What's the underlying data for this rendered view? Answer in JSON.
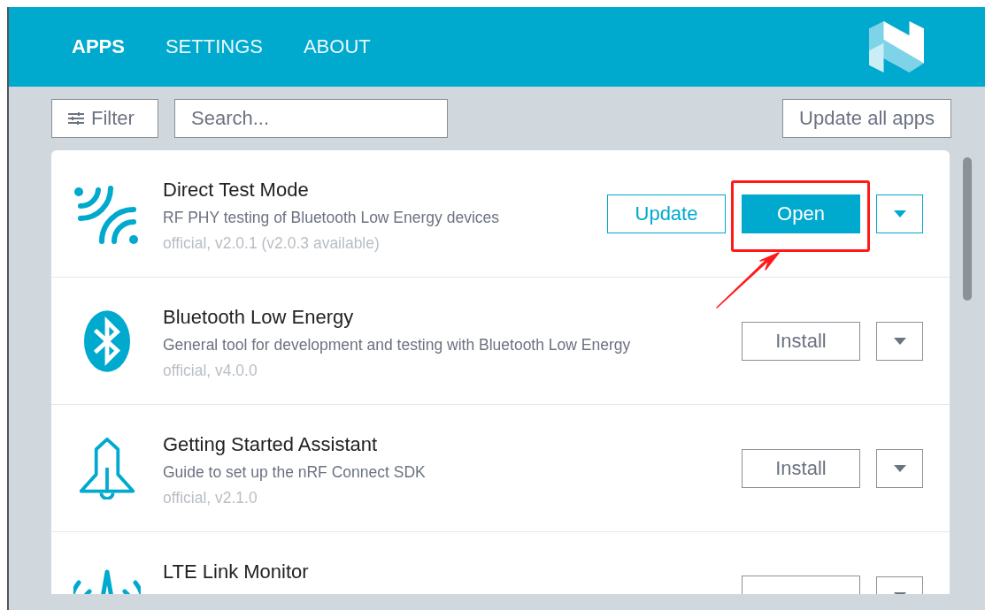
{
  "tabs": [
    {
      "label": "APPS",
      "selected": true
    },
    {
      "label": "SETTINGS",
      "selected": false
    },
    {
      "label": "ABOUT",
      "selected": false
    }
  ],
  "toolbar": {
    "filter": "Filter",
    "search": {
      "placeholder": "Search..."
    },
    "update_all": "Update all apps"
  },
  "apps": [
    {
      "kind": "waves",
      "name": "Direct Test Mode",
      "description": "RF PHY testing of Bluetooth Low Energy devices",
      "meta": "official, v2.0.1 (v2.0.3 available)",
      "actions": [
        {
          "kind": "update",
          "label": "Update"
        },
        {
          "kind": "open",
          "label": "Open",
          "highlighted": true
        },
        {
          "kind": "menu"
        }
      ]
    },
    {
      "kind": "bluetooth",
      "name": "Bluetooth Low Energy",
      "description": "General tool for development and testing with Bluetooth Low Energy",
      "meta": "official, v4.0.0",
      "actions": [
        {
          "kind": "install",
          "label": "Install"
        },
        {
          "kind": "menu"
        }
      ]
    },
    {
      "kind": "bell",
      "name": "Getting Started Assistant",
      "description": "Guide to set up the nRF Connect SDK",
      "meta": "official, v2.1.0",
      "actions": [
        {
          "kind": "install",
          "label": "Install"
        },
        {
          "kind": "menu"
        }
      ]
    },
    {
      "kind": "antenna",
      "name": "LTE Link Monitor",
      "actions": [
        {
          "kind": "install"
        },
        {
          "kind": "menu"
        }
      ]
    }
  ]
}
